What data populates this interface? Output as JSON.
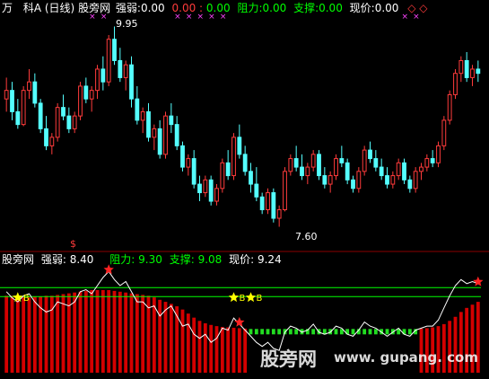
{
  "colors": {
    "up": "#ff3b3b",
    "down": "#54ffff",
    "bar_red": "#d40000",
    "bar_green": "#22dd22",
    "white": "#ffffff",
    "yellow": "#ffff00",
    "green": "#00ff00",
    "magenta": "#ff44ff",
    "divider": "#8b0000"
  },
  "top_legend": {
    "symbol_prefix": "万",
    "symbol": "科A (日线)",
    "indicator": "股旁网",
    "strength_label": "强弱:",
    "strength_value": "0.00",
    "v1": "0.00",
    "v2": "0.00",
    "resistance_label": "阻力:",
    "resistance_value": "0.00",
    "support_label": "支撑:",
    "support_value": "0.00",
    "price_label": "现价:",
    "price_value": "0.00",
    "end_marks": "◇ ◇"
  },
  "price_annotations": {
    "high_label": "9.95",
    "low_label": "7.60",
    "dollar_mark": "$"
  },
  "bottom_legend": {
    "indicator": "股旁网",
    "strength_label": "强弱:",
    "strength_value": "8.40",
    "resistance_label": "阻力:",
    "resistance_value": "9.30",
    "support_label": "支撑:",
    "support_value": "9.08",
    "price_label": "现价:",
    "price_value": "9.24"
  },
  "buy_marker_label": "B",
  "watermark": {
    "brand": "股旁网",
    "url": "www. gupang. com"
  },
  "chart_data": [
    {
      "type": "candlestick",
      "panel": "price",
      "y_range": [
        7.5,
        10.05
      ],
      "annotated_high": 9.95,
      "annotated_low": 7.6,
      "ohlc": [
        [
          9.1,
          9.35,
          8.95,
          9.2
        ],
        [
          9.2,
          9.3,
          8.85,
          8.95
        ],
        [
          8.95,
          9.1,
          8.75,
          8.8
        ],
        [
          8.8,
          9.25,
          8.78,
          9.2
        ],
        [
          9.2,
          9.45,
          9.1,
          9.3
        ],
        [
          9.3,
          9.4,
          9.0,
          9.05
        ],
        [
          9.05,
          9.1,
          8.7,
          8.75
        ],
        [
          8.75,
          8.9,
          8.5,
          8.55
        ],
        [
          8.55,
          8.7,
          8.45,
          8.65
        ],
        [
          8.65,
          9.05,
          8.6,
          9.0
        ],
        [
          9.0,
          9.15,
          8.85,
          8.9
        ],
        [
          8.9,
          9.0,
          8.7,
          8.75
        ],
        [
          8.75,
          8.95,
          8.7,
          8.9
        ],
        [
          8.9,
          9.3,
          8.85,
          9.25
        ],
        [
          9.25,
          9.35,
          9.05,
          9.1
        ],
        [
          9.1,
          9.25,
          8.95,
          9.2
        ],
        [
          9.2,
          9.5,
          9.1,
          9.45
        ],
        [
          9.45,
          9.6,
          9.2,
          9.3
        ],
        [
          9.3,
          9.85,
          9.25,
          9.8
        ],
        [
          9.8,
          9.95,
          9.5,
          9.55
        ],
        [
          9.55,
          9.7,
          9.3,
          9.35
        ],
        [
          9.35,
          9.55,
          9.2,
          9.5
        ],
        [
          9.5,
          9.6,
          9.0,
          9.1
        ],
        [
          9.1,
          9.25,
          8.8,
          8.85
        ],
        [
          8.85,
          9.0,
          8.7,
          8.95
        ],
        [
          8.95,
          9.05,
          8.6,
          8.65
        ],
        [
          8.65,
          8.8,
          8.5,
          8.75
        ],
        [
          8.75,
          8.85,
          8.4,
          8.45
        ],
        [
          8.45,
          8.95,
          8.4,
          8.9
        ],
        [
          8.9,
          9.05,
          8.7,
          8.8
        ],
        [
          8.8,
          8.9,
          8.5,
          8.55
        ],
        [
          8.55,
          8.6,
          8.25,
          8.3
        ],
        [
          8.3,
          8.45,
          8.2,
          8.4
        ],
        [
          8.4,
          8.5,
          8.05,
          8.1
        ],
        [
          8.1,
          8.2,
          7.9,
          8.0
        ],
        [
          8.0,
          8.2,
          7.95,
          8.15
        ],
        [
          8.15,
          8.2,
          7.85,
          7.9
        ],
        [
          7.9,
          8.1,
          7.85,
          8.05
        ],
        [
          8.05,
          8.4,
          8.0,
          8.35
        ],
        [
          8.35,
          8.5,
          8.15,
          8.2
        ],
        [
          8.2,
          8.7,
          8.15,
          8.65
        ],
        [
          8.65,
          8.8,
          8.4,
          8.45
        ],
        [
          8.45,
          8.55,
          8.2,
          8.25
        ],
        [
          8.25,
          8.35,
          8.0,
          8.1
        ],
        [
          8.1,
          8.3,
          7.9,
          7.95
        ],
        [
          7.95,
          8.0,
          7.75,
          7.8
        ],
        [
          7.8,
          8.05,
          7.75,
          8.0
        ],
        [
          8.0,
          8.05,
          7.65,
          7.7
        ],
        [
          7.7,
          7.85,
          7.6,
          7.8
        ],
        [
          7.8,
          8.3,
          7.78,
          8.25
        ],
        [
          8.25,
          8.45,
          8.2,
          8.4
        ],
        [
          8.4,
          8.55,
          8.25,
          8.3
        ],
        [
          8.3,
          8.45,
          8.15,
          8.2
        ],
        [
          8.2,
          8.35,
          8.1,
          8.3
        ],
        [
          8.3,
          8.5,
          8.25,
          8.45
        ],
        [
          8.45,
          8.5,
          8.15,
          8.2
        ],
        [
          8.2,
          8.3,
          8.05,
          8.1
        ],
        [
          8.1,
          8.25,
          8.0,
          8.2
        ],
        [
          8.2,
          8.45,
          8.15,
          8.4
        ],
        [
          8.4,
          8.55,
          8.3,
          8.35
        ],
        [
          8.35,
          8.4,
          8.1,
          8.15
        ],
        [
          8.15,
          8.2,
          8.0,
          8.05
        ],
        [
          8.05,
          8.3,
          8.0,
          8.25
        ],
        [
          8.25,
          8.55,
          8.2,
          8.5
        ],
        [
          8.5,
          8.6,
          8.35,
          8.4
        ],
        [
          8.4,
          8.5,
          8.25,
          8.3
        ],
        [
          8.3,
          8.4,
          8.15,
          8.2
        ],
        [
          8.2,
          8.3,
          8.05,
          8.1
        ],
        [
          8.1,
          8.25,
          8.05,
          8.2
        ],
        [
          8.2,
          8.4,
          8.15,
          8.35
        ],
        [
          8.35,
          8.4,
          8.1,
          8.15
        ],
        [
          8.15,
          8.2,
          8.0,
          8.05
        ],
        [
          8.05,
          8.3,
          8.0,
          8.25
        ],
        [
          8.25,
          8.35,
          8.15,
          8.3
        ],
        [
          8.3,
          8.45,
          8.25,
          8.4
        ],
        [
          8.4,
          8.5,
          8.3,
          8.35
        ],
        [
          8.35,
          8.6,
          8.3,
          8.55
        ],
        [
          8.55,
          8.9,
          8.5,
          8.85
        ],
        [
          8.85,
          9.2,
          8.8,
          9.15
        ],
        [
          9.15,
          9.45,
          9.1,
          9.4
        ],
        [
          9.4,
          9.6,
          9.3,
          9.55
        ],
        [
          9.55,
          9.65,
          9.3,
          9.35
        ],
        [
          9.35,
          9.5,
          9.25,
          9.45
        ],
        [
          9.45,
          9.55,
          9.3,
          9.4
        ]
      ]
    },
    {
      "type": "bar+line",
      "panel": "indicator",
      "y_range": [
        7.2,
        9.75
      ],
      "resistance": 9.3,
      "support": 9.08,
      "bars": [
        9.1,
        9.1,
        9.08,
        9.06,
        9.06,
        9.08,
        9.08,
        9.1,
        9.1,
        9.12,
        9.14,
        9.16,
        9.18,
        9.2,
        9.22,
        9.24,
        9.24,
        9.24,
        9.24,
        9.22,
        9.2,
        9.18,
        9.16,
        9.14,
        9.12,
        9.1,
        9.06,
        9.0,
        8.95,
        8.9,
        8.84,
        8.76,
        8.66,
        8.56,
        8.48,
        8.42,
        8.38,
        8.35,
        8.33,
        8.32,
        8.31,
        8.3,
        8.29,
        8.28,
        8.27,
        8.27,
        8.27,
        8.27,
        8.27,
        8.27,
        8.27,
        8.27,
        8.27,
        8.27,
        8.27,
        8.27,
        8.27,
        8.27,
        8.27,
        8.27,
        8.27,
        8.27,
        8.27,
        8.27,
        8.27,
        8.27,
        8.27,
        8.27,
        8.27,
        8.27,
        8.27,
        8.27,
        8.28,
        8.29,
        8.3,
        8.32,
        8.35,
        8.4,
        8.48,
        8.58,
        8.7,
        8.8,
        8.88,
        8.95
      ],
      "baseline": 8.28,
      "line": [
        9.2,
        9.05,
        8.95,
        9.1,
        9.15,
        8.95,
        8.8,
        8.7,
        8.75,
        8.95,
        8.9,
        8.85,
        8.95,
        9.2,
        9.25,
        9.15,
        9.35,
        9.55,
        9.7,
        9.5,
        9.35,
        9.45,
        9.2,
        8.95,
        8.95,
        8.8,
        8.85,
        8.6,
        8.75,
        8.85,
        8.6,
        8.35,
        8.4,
        8.15,
        8.05,
        8.15,
        7.95,
        8.05,
        8.3,
        8.25,
        8.55,
        8.4,
        8.25,
        8.1,
        7.95,
        7.85,
        7.95,
        7.8,
        7.75,
        8.2,
        8.35,
        8.3,
        8.2,
        8.25,
        8.4,
        8.2,
        8.15,
        8.2,
        8.35,
        8.3,
        8.15,
        8.1,
        8.25,
        8.45,
        8.35,
        8.3,
        8.2,
        8.1,
        8.2,
        8.3,
        8.15,
        8.1,
        8.25,
        8.3,
        8.35,
        8.35,
        8.5,
        8.8,
        9.1,
        9.35,
        9.5,
        9.4,
        9.45,
        9.4
      ],
      "buy_signal_indices": [
        2,
        40,
        43
      ],
      "star_indices": [
        18,
        41,
        83
      ]
    }
  ]
}
